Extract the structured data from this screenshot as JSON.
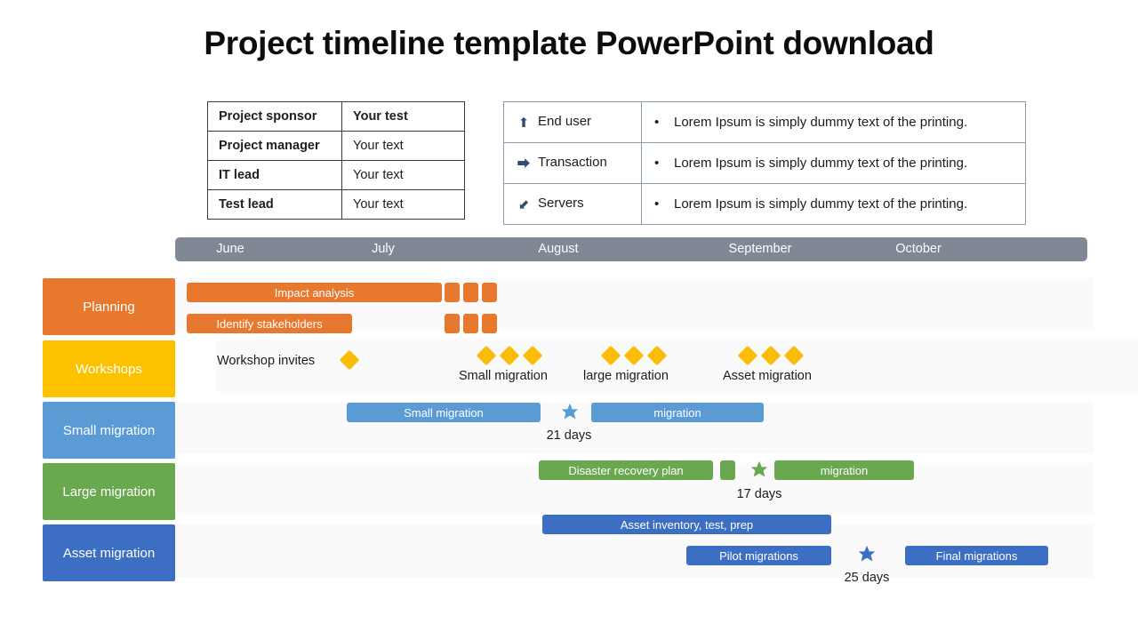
{
  "title": "Project timeline template PowerPoint download",
  "roles_table": {
    "rows": [
      {
        "name": "Project sponsor",
        "value": "Your test"
      },
      {
        "name": "Project manager",
        "value": "Your text"
      },
      {
        "name": "IT lead",
        "value": "Your text"
      },
      {
        "name": "Test lead",
        "value": "Your text"
      }
    ]
  },
  "scope_table": {
    "bullet": "•",
    "rows": [
      {
        "icon": "arrow-up-icon",
        "glyph": "⬆",
        "label": "End user",
        "desc": "Lorem Ipsum is simply dummy text of the printing."
      },
      {
        "icon": "arrow-right-icon",
        "glyph": "⮕",
        "label": "Transaction",
        "desc": "Lorem Ipsum is simply dummy text of the printing."
      },
      {
        "icon": "arrow-down-left-icon",
        "glyph": "⬋",
        "label": "Servers",
        "desc": "Lorem Ipsum is simply dummy text of the printing."
      }
    ]
  },
  "timeline": {
    "months": [
      "June",
      "July",
      "August",
      "September",
      "October"
    ],
    "month_bar_color": "#7f8894",
    "rows": [
      {
        "name": "Planning",
        "color": "#e8782d",
        "bars": [
          {
            "label": "Impact analysis"
          },
          {
            "label": "Identify stakeholders"
          }
        ]
      },
      {
        "name": "Workshops",
        "color": "#fcc200",
        "milestone_color": "#fbbc05",
        "labels": [
          "Workshop invites",
          "Small migration",
          "large migration",
          "Asset  migration"
        ]
      },
      {
        "name": "Small migration",
        "color": "#5b9bd5",
        "bars": [
          {
            "label": "Small migration"
          },
          {
            "label": "migration"
          }
        ],
        "duration": "21 days"
      },
      {
        "name": "Large migration",
        "color": "#6aa84f",
        "bars": [
          {
            "label": "Disaster recovery plan"
          },
          {
            "label": "migration"
          }
        ],
        "duration": "17 days"
      },
      {
        "name": "Asset migration",
        "color": "#3c6fc4",
        "bars": [
          {
            "label": "Asset inventory, test, prep"
          },
          {
            "label": "Pilot migrations"
          },
          {
            "label": "Final migrations"
          }
        ],
        "duration": "25 days"
      }
    ]
  }
}
